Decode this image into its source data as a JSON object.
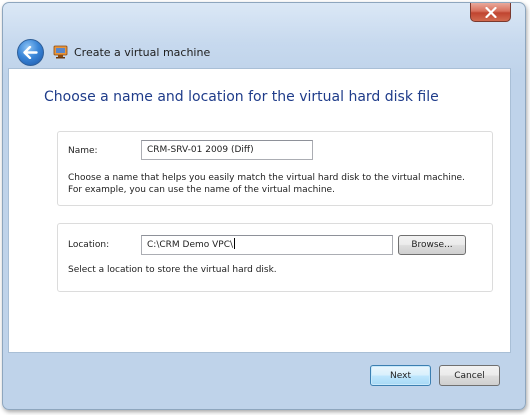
{
  "window": {
    "title": "Create a virtual machine"
  },
  "page": {
    "heading": "Choose a name and location for the virtual hard disk file"
  },
  "name_section": {
    "label": "Name:",
    "value": "CRM-SRV-01 2009 (Diff)",
    "description_line1": "Choose a name that helps you easily match the virtual hard disk to the virtual machine.",
    "description_line2": "For example, you can use the name of the virtual machine."
  },
  "location_section": {
    "label": "Location:",
    "value": "C:\\CRM Demo VPC\\",
    "browse_label": "Browse...",
    "description": "Select a location to store the virtual hard disk."
  },
  "footer": {
    "next_label": "Next",
    "cancel_label": "Cancel"
  },
  "icons": {
    "back": "back-arrow-icon",
    "app": "virtual-pc-icon",
    "close": "close-icon"
  }
}
